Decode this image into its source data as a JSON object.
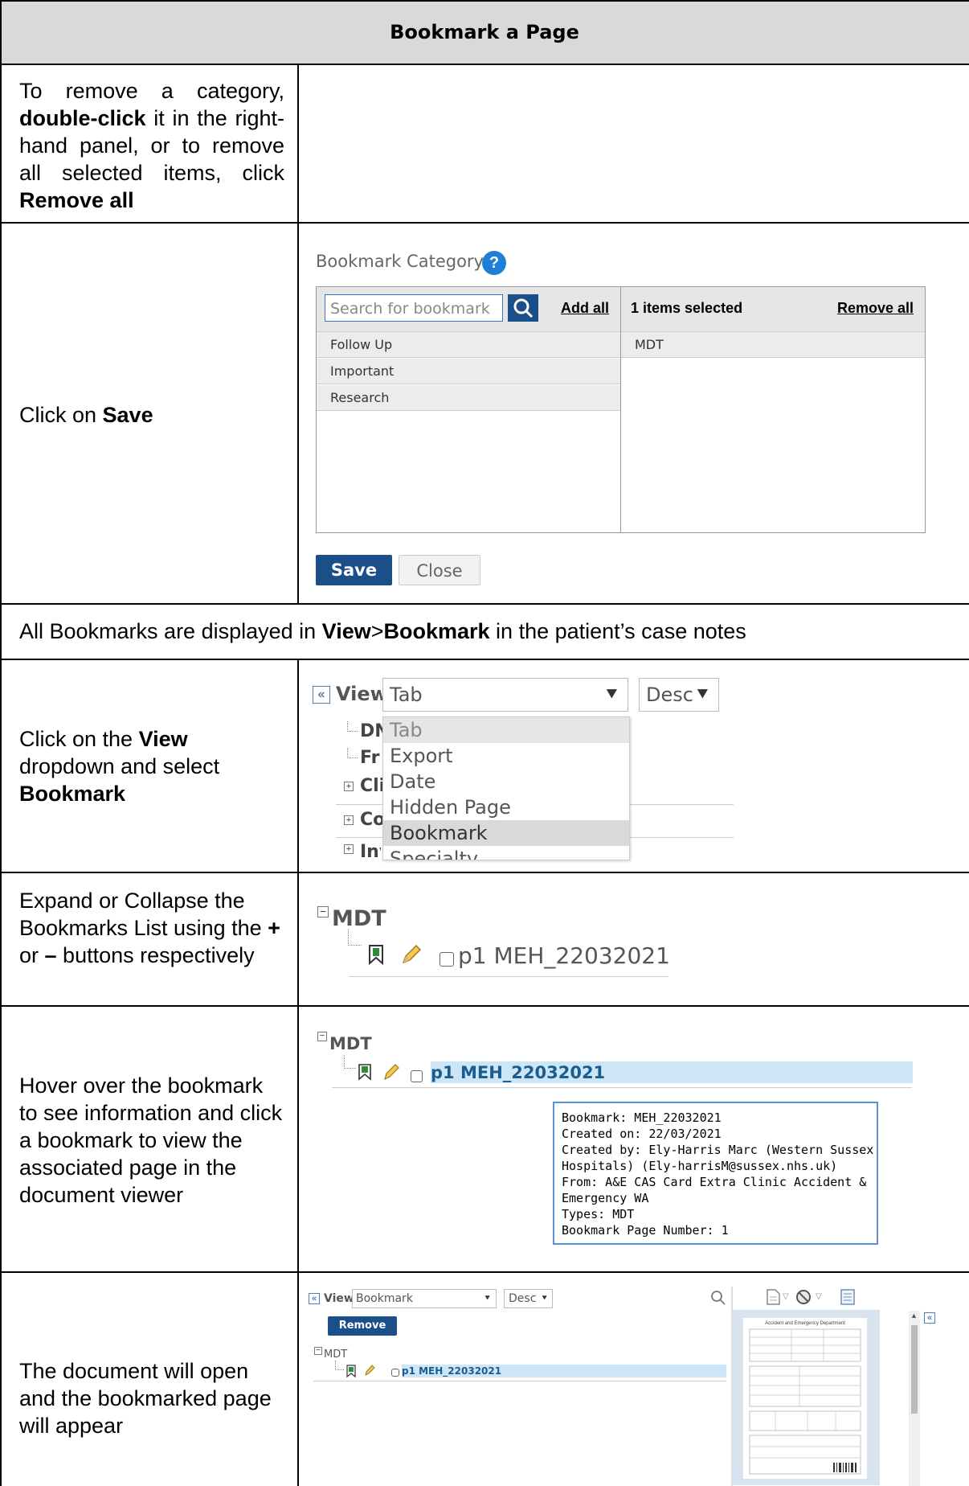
{
  "header": {
    "title": "Bookmark a Page"
  },
  "rows": {
    "r1": {
      "t1": "To remove a category, ",
      "b1": "double-click",
      "t2": " it in the right-hand panel, or to remove all selected items, click ",
      "b2": "Remove all"
    },
    "r2": {
      "t1": "Click on ",
      "b1": "Save"
    },
    "r3": {
      "t1": "All Bookmarks are displayed in ",
      "b1": "View",
      "t2": ">",
      "b2": "Bookmark",
      "t3": " in the patient’s case notes"
    },
    "r4": {
      "t1": "Click on the ",
      "b1": "View",
      "t2": " dropdown and select ",
      "b2": "Bookmark"
    },
    "r5": {
      "t1": "Expand or Collapse the Bookmarks List using the ",
      "b1": "+",
      "t2": " or ",
      "b2": "–",
      "t3": " buttons respectively"
    },
    "r6": {
      "t1": "Hover over the bookmark to see information and click a bookmark to view the associated page in the document viewer"
    },
    "r7": {
      "t1": "The document will open and the bookmarked page will appear"
    }
  },
  "dialog": {
    "label": "Bookmark Category:",
    "help": "?",
    "search_placeholder": "Search for bookmark",
    "add_all": "Add all",
    "available": [
      "Follow Up",
      "Important",
      "Research"
    ],
    "selected_count": "1 items selected",
    "remove_all": "Remove all",
    "selected": [
      "MDT"
    ],
    "save": "Save",
    "close": "Close"
  },
  "viewbar": {
    "collapse": "«",
    "view_label": "View",
    "view_value": "Tab",
    "sort_value": "Desc",
    "menu": [
      "Tab",
      "Export",
      "Date",
      "Hidden Page",
      "Bookmark",
      "Specialty"
    ],
    "tree": [
      "DN",
      "Fr",
      "Cli",
      "Co",
      "Inv"
    ]
  },
  "tree": {
    "group": "MDT",
    "item": "p1 MEH_22032021"
  },
  "tooltip": {
    "lines": [
      "Bookmark: MEH_22032021",
      "Created on: 22/03/2021",
      "Created by: Ely-Harris Marc (Western Sussex",
      "Hospitals) (Ely-harrisM@sussex.nhs.uk)",
      "From: A&E CAS Card Extra Clinic Accident &",
      "Emergency WA",
      "Types: MDT",
      "Bookmark Page Number: 1"
    ]
  },
  "viewer": {
    "view_value": "Bookmark",
    "sort_value": "Desc",
    "remove": "Remove",
    "doc_title": "Accident and Emergency Department"
  },
  "colors": {
    "accent": "#1b4f8a",
    "highlight": "#cce6f7",
    "header_bg": "#d9d9d9"
  }
}
